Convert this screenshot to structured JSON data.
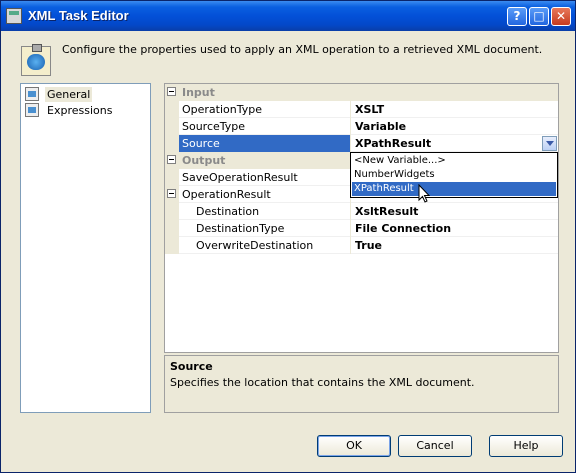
{
  "window": {
    "title": "XML Task Editor"
  },
  "header": {
    "description": "Configure the properties used to apply an XML operation to a retrieved XML document."
  },
  "nav": {
    "items": [
      {
        "label": "General"
      },
      {
        "label": "Expressions"
      }
    ]
  },
  "grid": {
    "input_category": "Input",
    "operation_type": {
      "name": "OperationType",
      "value": "XSLT"
    },
    "source_type": {
      "name": "SourceType",
      "value": "Variable"
    },
    "source": {
      "name": "Source",
      "value": "XPathResult"
    },
    "output_category": "Output",
    "save_operation_result": {
      "name": "SaveOperationResult"
    },
    "operation_result": {
      "name": "OperationResult"
    },
    "destination": {
      "name": "Destination",
      "value": "XsltResult"
    },
    "destination_type": {
      "name": "DestinationType",
      "value": "File Connection"
    },
    "overwrite_destination": {
      "name": "OverwriteDestination",
      "value": "True"
    }
  },
  "dropdown": {
    "options": [
      "<New Variable...>",
      "NumberWidgets",
      "XPathResult"
    ]
  },
  "description": {
    "title": "Source",
    "text": "Specifies the location that contains the XML document."
  },
  "buttons": {
    "ok": "OK",
    "cancel": "Cancel",
    "help": "Help"
  }
}
